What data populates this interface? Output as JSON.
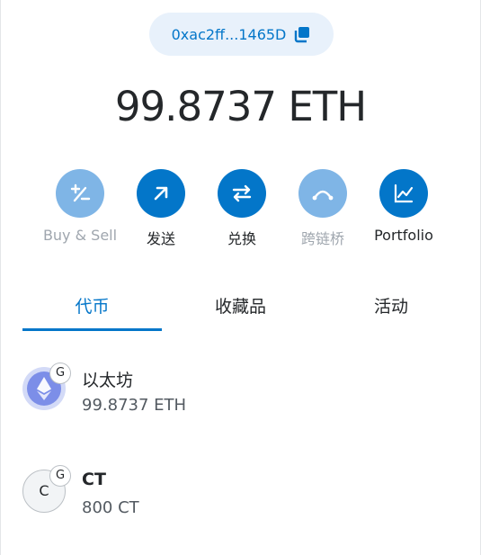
{
  "account": {
    "address_short": "0xac2ff...1465D"
  },
  "balance": {
    "text": "99.8737 ETH"
  },
  "actions": [
    {
      "label": "Buy & Sell",
      "icon": "plus-minus-icon",
      "enabled": false
    },
    {
      "label": "发送",
      "icon": "arrow-up-right-icon",
      "enabled": true
    },
    {
      "label": "兑换",
      "icon": "swap-arrows-icon",
      "enabled": true
    },
    {
      "label": "跨链桥",
      "icon": "bridge-icon",
      "enabled": false
    },
    {
      "label": "Portfolio",
      "icon": "chart-icon",
      "enabled": true
    }
  ],
  "tabs": [
    {
      "label": "代币",
      "active": true
    },
    {
      "label": "收藏品",
      "active": false
    },
    {
      "label": "活动",
      "active": false
    }
  ],
  "assets": [
    {
      "name": "以太坊",
      "amount": "99.8737 ETH",
      "badge": "G",
      "icon": "ethereum-icon"
    },
    {
      "name": "CT",
      "amount": "800 CT",
      "badge": "G",
      "icon_letter": "C"
    }
  ],
  "colors": {
    "accent": "#0376c9",
    "accent_disabled": "#7fb5e6",
    "pill_bg": "#e8f1fb",
    "text": "#24272a",
    "muted": "#9fa6ae"
  }
}
